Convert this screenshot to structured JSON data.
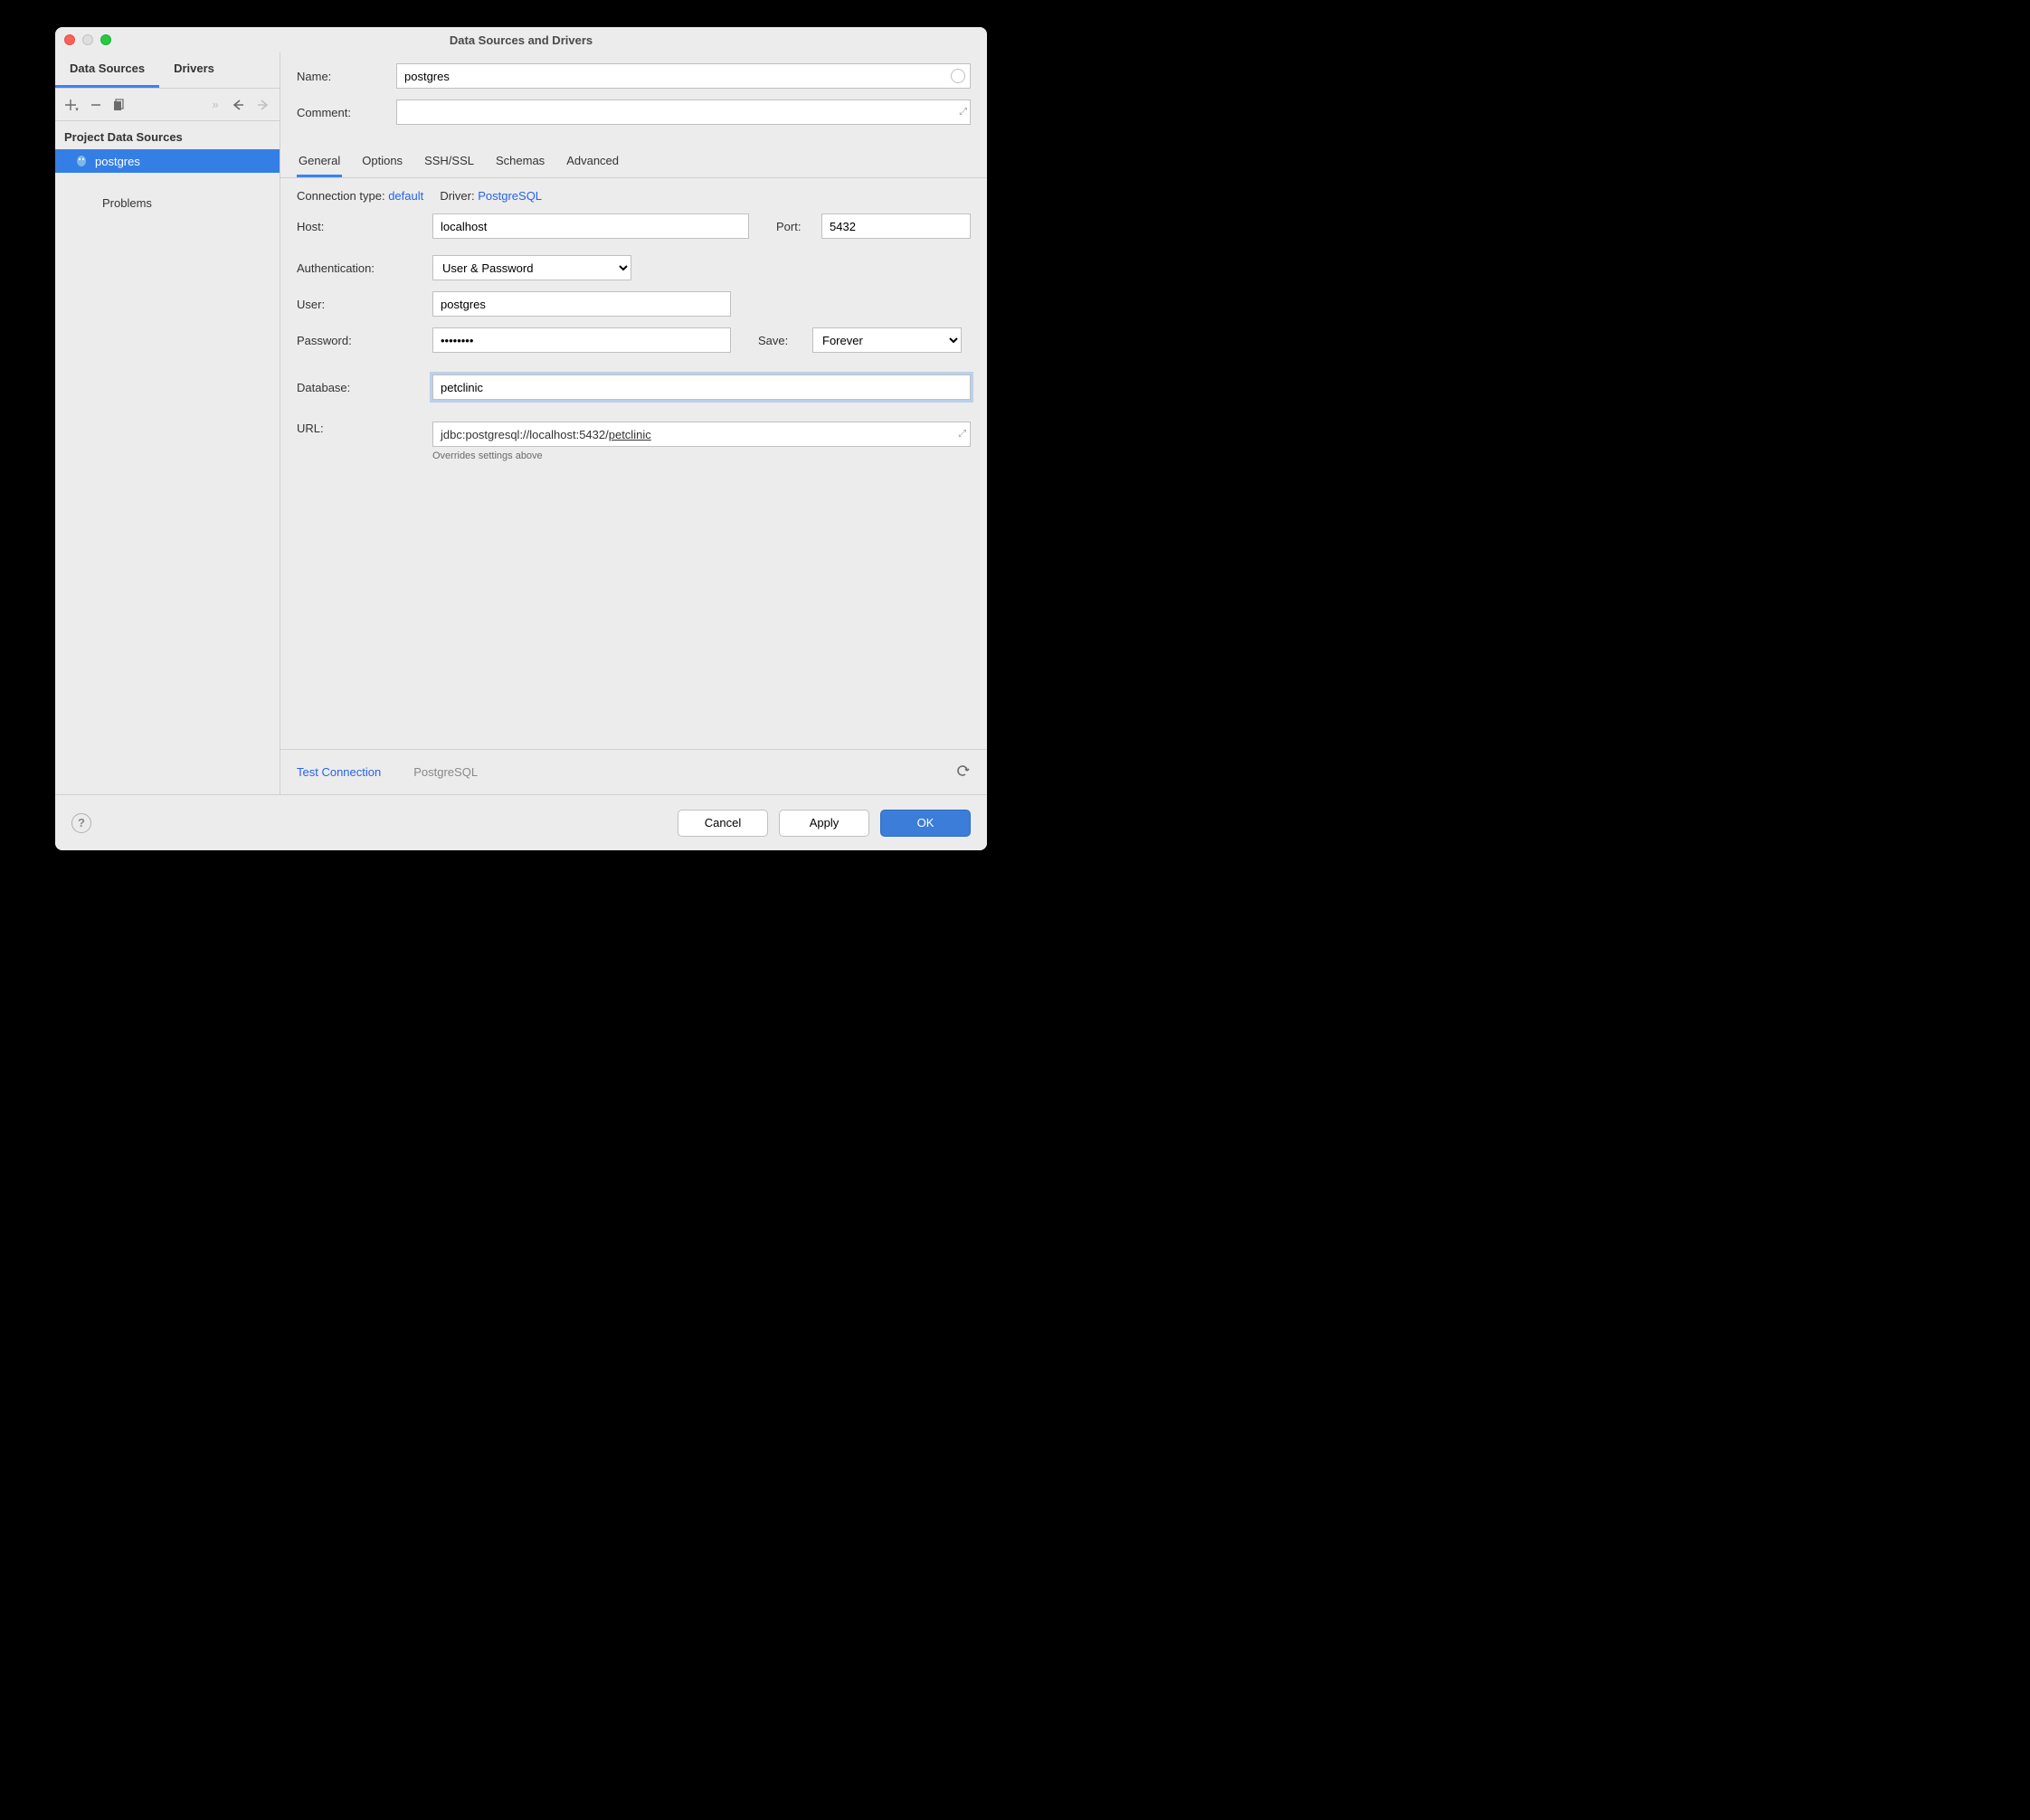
{
  "window": {
    "title": "Data Sources and Drivers"
  },
  "sidebar": {
    "tabs": {
      "data_sources": "Data Sources",
      "drivers": "Drivers"
    },
    "section": "Project Data Sources",
    "items": [
      {
        "label": "postgres"
      }
    ],
    "problems": "Problems"
  },
  "form": {
    "name_label": "Name:",
    "name_value": "postgres",
    "comment_label": "Comment:",
    "comment_value": ""
  },
  "inner_tabs": {
    "general": "General",
    "options": "Options",
    "sshssl": "SSH/SSL",
    "schemas": "Schemas",
    "advanced": "Advanced"
  },
  "conn": {
    "type_label": "Connection type:",
    "type_value": "default",
    "driver_label": "Driver:",
    "driver_value": "PostgreSQL"
  },
  "fields": {
    "host_label": "Host:",
    "host_value": "localhost",
    "port_label": "Port:",
    "port_value": "5432",
    "auth_label": "Authentication:",
    "auth_value": "User & Password",
    "user_label": "User:",
    "user_value": "postgres",
    "password_label": "Password:",
    "password_value": "••••••••",
    "save_label": "Save:",
    "save_value": "Forever",
    "database_label": "Database:",
    "database_value": "petclinic",
    "url_label": "URL:",
    "url_prefix": "jdbc:postgresql://localhost:5432/",
    "url_suffix": "petclinic",
    "url_note": "Overrides settings above"
  },
  "testbar": {
    "test": "Test Connection",
    "driver": "PostgreSQL"
  },
  "footer": {
    "cancel": "Cancel",
    "apply": "Apply",
    "ok": "OK"
  }
}
